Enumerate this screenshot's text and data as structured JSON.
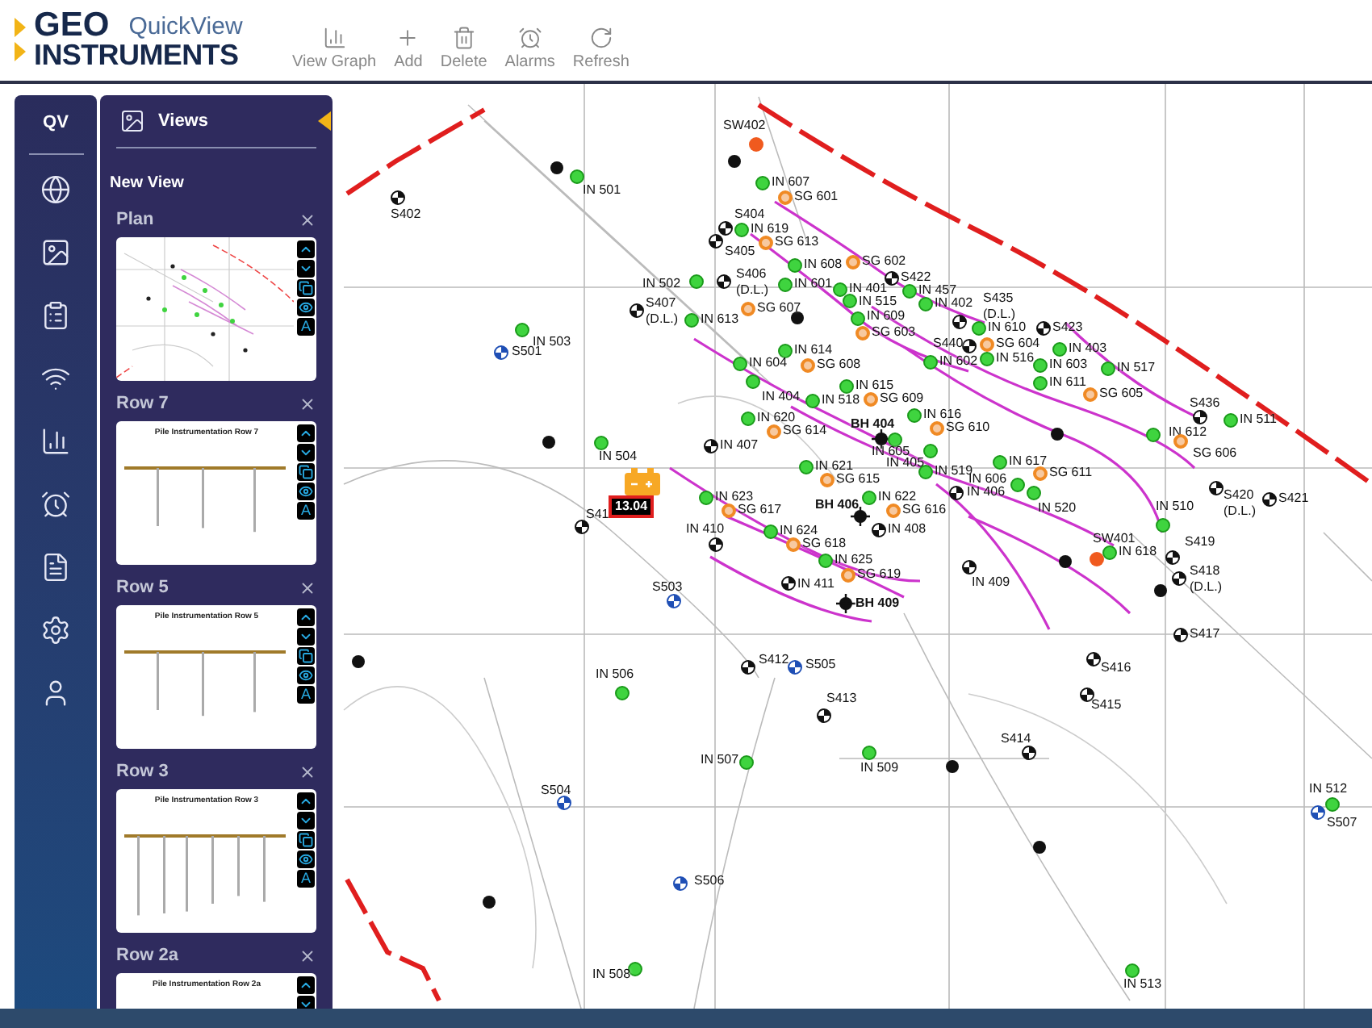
{
  "header": {
    "logo_top": "GEO",
    "logo_bottom": "INSTRUMENTS",
    "app_name": "QuickView"
  },
  "toolbar": [
    {
      "label": "View Graph",
      "kind": "graph"
    },
    {
      "label": "Add",
      "kind": "add"
    },
    {
      "label": "Delete",
      "kind": "delete"
    },
    {
      "label": "Alarms",
      "kind": "alarm"
    },
    {
      "label": "Refresh",
      "kind": "refresh"
    }
  ],
  "rail": {
    "title": "QV",
    "items": [
      {
        "kind": "globe"
      },
      {
        "kind": "image"
      },
      {
        "kind": "clipboard"
      },
      {
        "kind": "wireless"
      },
      {
        "kind": "chart"
      },
      {
        "kind": "alarm"
      },
      {
        "kind": "report"
      },
      {
        "kind": "settings"
      },
      {
        "kind": "user"
      }
    ]
  },
  "views_panel": {
    "title": "Views",
    "new_view": "New View",
    "views": [
      {
        "title": "Plan",
        "kind": "plan",
        "text_control": "A"
      },
      {
        "title": "Row 7",
        "kind": "row",
        "thumb_title": "Pile Instrumentation Row 7",
        "text_control": "A"
      },
      {
        "title": "Row 5",
        "kind": "row",
        "thumb_title": "Pile Instrumentation Row 5",
        "text_control": "A"
      },
      {
        "title": "Row 3",
        "kind": "row",
        "thumb_title": "Pile Instrumentation Row 3",
        "text_control": "A"
      },
      {
        "title": "Row 2a",
        "kind": "row",
        "thumb_title": "Pile Instrumentation Row 2a"
      }
    ]
  },
  "map": {
    "battery": {
      "reading": "13.04"
    },
    "markers": [
      {
        "label": "SW402",
        "kind": "standpipe"
      },
      {
        "label": "IN 501",
        "kind": "inclinometer"
      },
      {
        "label": "IN 607",
        "kind": "inclinometer"
      },
      {
        "label": "SG 601",
        "kind": "strain_gauge"
      },
      {
        "label": "S402",
        "kind": "settlement"
      },
      {
        "label": "S404",
        "kind": "settlement"
      },
      {
        "label": "IN 619",
        "kind": "inclinometer"
      },
      {
        "label": "S405",
        "kind": "settlement"
      },
      {
        "label": "SG 613",
        "kind": "strain_gauge"
      },
      {
        "label": "IN 608",
        "kind": "inclinometer"
      },
      {
        "label": "SG 602",
        "kind": "strain_gauge"
      },
      {
        "label": "IN 502",
        "kind": "inclinometer"
      },
      {
        "label": "S406",
        "note": "(D.L.)",
        "kind": "settlement"
      },
      {
        "label": "IN 601",
        "kind": "inclinometer"
      },
      {
        "label": "IN 401",
        "kind": "inclinometer"
      },
      {
        "label": "S422",
        "kind": "settlement"
      },
      {
        "label": "IN 457",
        "kind": "inclinometer"
      },
      {
        "label": "S407",
        "note": "(D.L.)",
        "kind": "settlement"
      },
      {
        "label": "IN 613",
        "kind": "inclinometer"
      },
      {
        "label": "SG 607",
        "kind": "strain_gauge"
      },
      {
        "label": "IN 515",
        "kind": "inclinometer"
      },
      {
        "label": "IN 609",
        "kind": "inclinometer"
      },
      {
        "label": "IN 402",
        "kind": "inclinometer"
      },
      {
        "label": "S435",
        "note": "(D.L.)",
        "kind": "settlement"
      },
      {
        "label": "SG 603",
        "kind": "strain_gauge"
      },
      {
        "label": "IN 610",
        "kind": "inclinometer"
      },
      {
        "label": "S423",
        "kind": "settlement"
      },
      {
        "label": "S501",
        "kind": "piezometer"
      },
      {
        "label": "IN 503",
        "kind": "inclinometer"
      },
      {
        "label": "IN 614",
        "kind": "inclinometer"
      },
      {
        "label": "S440",
        "kind": "settlement"
      },
      {
        "label": "SG 604",
        "kind": "strain_gauge"
      },
      {
        "label": "IN 403",
        "kind": "inclinometer"
      },
      {
        "label": "IN 604",
        "kind": "inclinometer"
      },
      {
        "label": "SG 608",
        "kind": "strain_gauge"
      },
      {
        "label": "IN 602",
        "kind": "inclinometer"
      },
      {
        "label": "IN 516",
        "kind": "inclinometer"
      },
      {
        "label": "IN 603",
        "kind": "inclinometer"
      },
      {
        "label": "IN 517",
        "kind": "inclinometer"
      },
      {
        "label": "IN 615",
        "kind": "inclinometer"
      },
      {
        "label": "IN 611",
        "kind": "inclinometer"
      },
      {
        "label": "IN 404",
        "kind": "inclinometer"
      },
      {
        "label": "IN 518",
        "kind": "inclinometer"
      },
      {
        "label": "SG 609",
        "kind": "strain_gauge"
      },
      {
        "label": "SG 605",
        "kind": "strain_gauge"
      },
      {
        "label": "S436",
        "kind": "settlement"
      },
      {
        "label": "IN 620",
        "kind": "inclinometer"
      },
      {
        "label": "IN 616",
        "kind": "inclinometer"
      },
      {
        "label": "IN 511",
        "kind": "inclinometer"
      },
      {
        "label": "SG 614",
        "kind": "strain_gauge"
      },
      {
        "label": "BH 404",
        "kind": "borehole"
      },
      {
        "label": "SG 610",
        "kind": "strain_gauge"
      },
      {
        "label": "IN 612",
        "kind": "inclinometer"
      },
      {
        "label": "IN 504",
        "kind": "inclinometer"
      },
      {
        "label": "IN 407",
        "kind": "settlement"
      },
      {
        "label": "IN 605",
        "kind": "inclinometer"
      },
      {
        "label": "SG 606",
        "kind": "strain_gauge"
      },
      {
        "label": "IN 621",
        "kind": "inclinometer"
      },
      {
        "label": "IN 405",
        "kind": "inclinometer"
      },
      {
        "label": "IN 519",
        "kind": "inclinometer"
      },
      {
        "label": "IN 617",
        "kind": "inclinometer"
      },
      {
        "label": "SG 611",
        "kind": "strain_gauge"
      },
      {
        "label": "SG 615",
        "kind": "strain_gauge"
      },
      {
        "label": "IN 606",
        "kind": "inclinometer"
      },
      {
        "label": "IN 623",
        "kind": "inclinometer"
      },
      {
        "label": "IN 622",
        "kind": "inclinometer"
      },
      {
        "label": "IN 406",
        "kind": "settlement"
      },
      {
        "label": "S420",
        "note": "(D.L.)",
        "kind": "settlement"
      },
      {
        "label": "S421",
        "kind": "settlement"
      },
      {
        "label": "S41",
        "kind": "settlement"
      },
      {
        "label": "SG 617",
        "kind": "strain_gauge"
      },
      {
        "label": "BH 406",
        "kind": "borehole"
      },
      {
        "label": "SG 616",
        "kind": "strain_gauge"
      },
      {
        "label": "IN 520",
        "kind": "inclinometer"
      },
      {
        "label": "IN 510",
        "kind": "inclinometer"
      },
      {
        "label": "IN 410",
        "kind": "settlement"
      },
      {
        "label": "IN 624",
        "kind": "inclinometer"
      },
      {
        "label": "IN 408",
        "kind": "settlement"
      },
      {
        "label": "SG 618",
        "kind": "strain_gauge"
      },
      {
        "label": "SW401",
        "kind": "standpipe"
      },
      {
        "label": "IN 618",
        "kind": "inclinometer"
      },
      {
        "label": "S419",
        "kind": "settlement"
      },
      {
        "label": "IN 625",
        "kind": "inclinometer"
      },
      {
        "label": "S503",
        "kind": "piezometer"
      },
      {
        "label": "IN 411",
        "kind": "settlement"
      },
      {
        "label": "SG 619",
        "kind": "strain_gauge"
      },
      {
        "label": "IN 409",
        "kind": "settlement"
      },
      {
        "label": "S418",
        "note": "(D.L.)",
        "kind": "settlement"
      },
      {
        "label": "BH 409",
        "kind": "borehole"
      },
      {
        "label": "S417",
        "kind": "settlement"
      },
      {
        "label": "IN 506",
        "kind": "inclinometer"
      },
      {
        "label": "S412",
        "kind": "settlement"
      },
      {
        "label": "S505",
        "kind": "piezometer"
      },
      {
        "label": "S416",
        "kind": "settlement"
      },
      {
        "label": "S413",
        "kind": "settlement"
      },
      {
        "label": "S415",
        "kind": "settlement"
      },
      {
        "label": "S414",
        "kind": "settlement"
      },
      {
        "label": "IN 507",
        "kind": "inclinometer"
      },
      {
        "label": "IN 509",
        "kind": "inclinometer"
      },
      {
        "label": "S504",
        "kind": "piezometer"
      },
      {
        "label": "IN 512",
        "kind": "inclinometer"
      },
      {
        "label": "S507",
        "kind": "piezometer"
      },
      {
        "label": "S506",
        "kind": "piezometer"
      },
      {
        "label": "IN 508",
        "kind": "inclinometer"
      },
      {
        "label": "IN 513",
        "kind": "inclinometer"
      }
    ]
  }
}
